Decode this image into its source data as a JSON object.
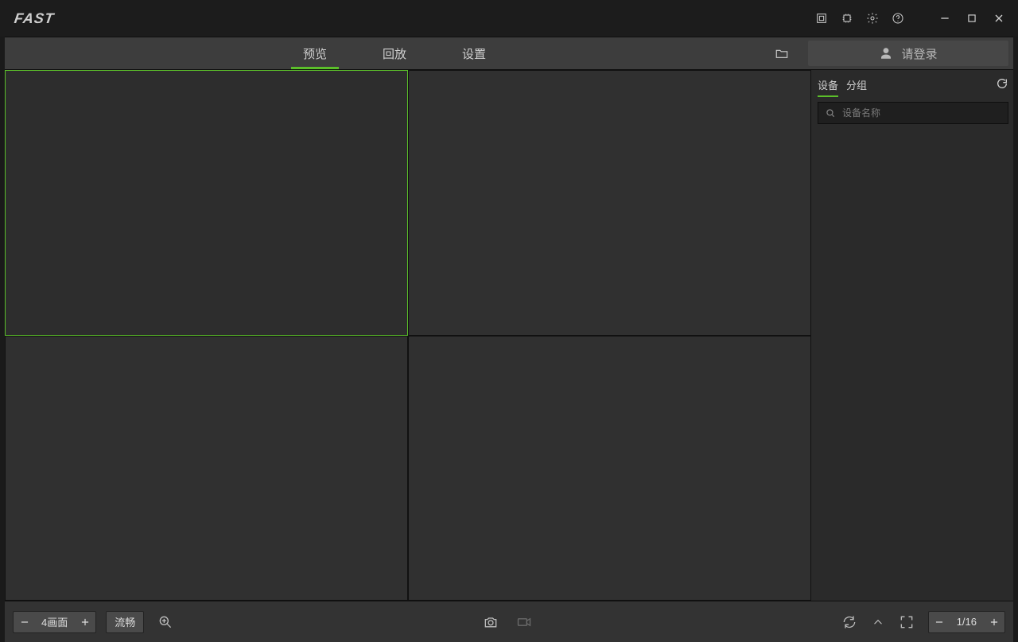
{
  "app": {
    "logo_text": "FAST"
  },
  "titlebar_icons": {
    "screenshot": "screenshot-icon",
    "cpu": "cpu-icon",
    "settings": "gear-icon",
    "help": "help-icon"
  },
  "tabs": {
    "preview": "预览",
    "playback": "回放",
    "settings": "设置",
    "active": "preview"
  },
  "login": {
    "label": "请登录"
  },
  "sidebar": {
    "tab_device": "设备",
    "tab_group": "分组",
    "active": "device",
    "search_placeholder": "设备名称"
  },
  "footer": {
    "layout_label": "4画面",
    "quality_label": "流畅",
    "page_indicator": "1/16"
  },
  "grid": {
    "rows": 2,
    "cols": 2,
    "selected_index": 0
  }
}
